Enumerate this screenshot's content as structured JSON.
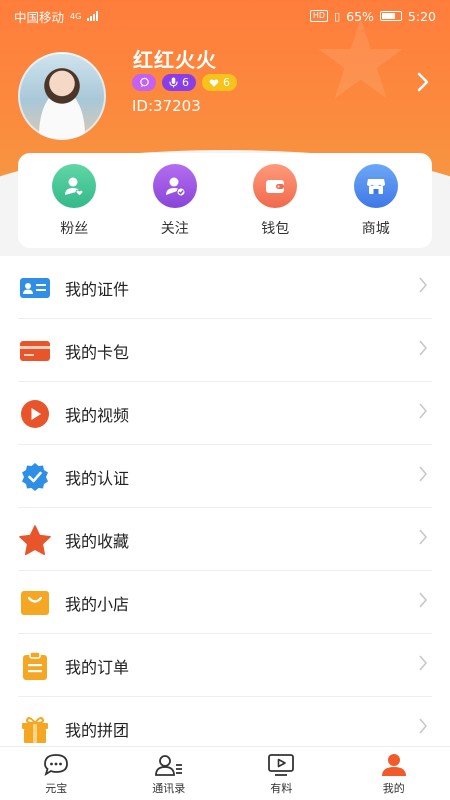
{
  "status_bar": {
    "carrier": "中国移动",
    "network": "4G",
    "battery": "65%",
    "time": "5:20"
  },
  "profile": {
    "name": "红红火火",
    "id_text": "ID:37203",
    "badge_voice_count": "6",
    "badge_heart_count": "6"
  },
  "quick_actions": [
    {
      "label": "粉丝",
      "icon": "fans-icon"
    },
    {
      "label": "关注",
      "icon": "follow-icon"
    },
    {
      "label": "钱包",
      "icon": "wallet-icon"
    },
    {
      "label": "商城",
      "icon": "mall-icon"
    }
  ],
  "menu": [
    {
      "label": "我的证件",
      "icon": "id-card-icon"
    },
    {
      "label": "我的卡包",
      "icon": "card-wallet-icon"
    },
    {
      "label": "我的视频",
      "icon": "video-icon"
    },
    {
      "label": "我的认证",
      "icon": "verified-icon"
    },
    {
      "label": "我的收藏",
      "icon": "star-icon"
    },
    {
      "label": "我的小店",
      "icon": "shop-icon"
    },
    {
      "label": "我的订单",
      "icon": "order-icon"
    },
    {
      "label": "我的拼团",
      "icon": "group-buy-icon"
    }
  ],
  "tabs": [
    {
      "label": "元宝",
      "icon": "chat-icon"
    },
    {
      "label": "通讯录",
      "icon": "contacts-icon"
    },
    {
      "label": "有料",
      "icon": "tv-icon"
    },
    {
      "label": "我的",
      "icon": "user-icon",
      "active": true
    }
  ],
  "colors": {
    "header_gradient_start": "#ff7d3b",
    "header_gradient_end": "#f59a43",
    "active_tab": "#f2592b"
  }
}
